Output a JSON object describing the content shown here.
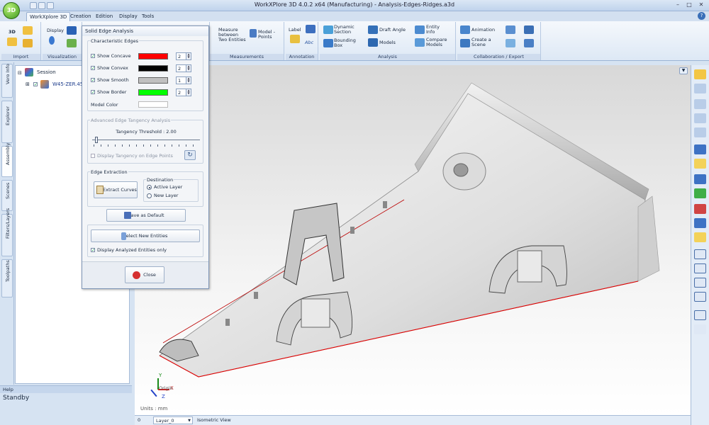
{
  "window": {
    "title": "WorkXPlore 3D 4.0.2 x64 (Manufacturing) - Analysis-Edges-Ridges.a3d",
    "logo_text": "3D",
    "help_glyph": "?"
  },
  "menu": {
    "tabs": [
      "WorkXplore 3D",
      "Creation",
      "Edition",
      "Display",
      "Tools"
    ]
  },
  "ribbon": {
    "import": {
      "label": "Import",
      "btn_3d": "3D"
    },
    "visualization": {
      "label": "Visualization",
      "display": "Display"
    },
    "measurements": {
      "label": "Measurements",
      "measure_between": "Measure between Two Entities",
      "model_points": "Model - Points"
    },
    "annotation": {
      "label": "Annotation",
      "label_btn": "Label",
      "abc": "Abc"
    },
    "analysis": {
      "label": "Analysis",
      "dynamic_section": "Dynamic Section",
      "bounding_box": "Bounding Box",
      "draft_angle": "Draft Angle",
      "models": "Models",
      "entity_info": "Entity Info",
      "compare_models": "Compare Models"
    },
    "collab": {
      "label": "Collaboration / Export",
      "animation": "Animation",
      "create_scene": "Create a Scene"
    }
  },
  "left_panel": {
    "vertical_tabs": [
      "Vero Info",
      "Explorer",
      "Assembly",
      "Scenes",
      "Filters/Layers",
      "Toolpaths"
    ],
    "active_tab": "Assembly",
    "tree": {
      "session": "Session",
      "part": "W45-ZER.452"
    },
    "help_title": "Help",
    "help_status": "Standby"
  },
  "dialog": {
    "title": "Solid Edge Analysis",
    "characteristic_edges": {
      "legend": "Characteristic Edges",
      "rows": [
        {
          "label": "Show Concave",
          "checked": true,
          "color": "#ff0000",
          "value": "2"
        },
        {
          "label": "Show Convex",
          "checked": true,
          "color": "#000000",
          "value": "2"
        },
        {
          "label": "Show Smooth",
          "checked": true,
          "color": "#c0c0c0",
          "value": "1"
        },
        {
          "label": "Show Border",
          "checked": true,
          "color": "#00ff00",
          "value": "2"
        }
      ],
      "model_color_label": "Model Color",
      "model_color": "#ffffff"
    },
    "tangency": {
      "legend": "Advanced Edge Tangency Analysis",
      "threshold_label": "Tangency Threshold : 2.00",
      "slider_value": 0.05,
      "display_tangency": "Display Tangency on Edge Points"
    },
    "extraction": {
      "legend": "Edge Extraction",
      "extract_button": "Extract Curves",
      "destination_legend": "Destination",
      "active_layer": "Active Layer",
      "new_layer": "New Layer",
      "selected": "Active Layer"
    },
    "save_default": "Save as Default",
    "select_new": "Select New Entities",
    "display_analyzed": "Display Analyzed Entities only",
    "close": "Close"
  },
  "viewport": {
    "units": "Units : mm",
    "origin_label": "Origin",
    "axis_y": "Y",
    "axis_x": "X",
    "axis_z": "Z"
  },
  "status": {
    "coord": "0",
    "layer": "Layer_0",
    "view": "Isometric View"
  }
}
